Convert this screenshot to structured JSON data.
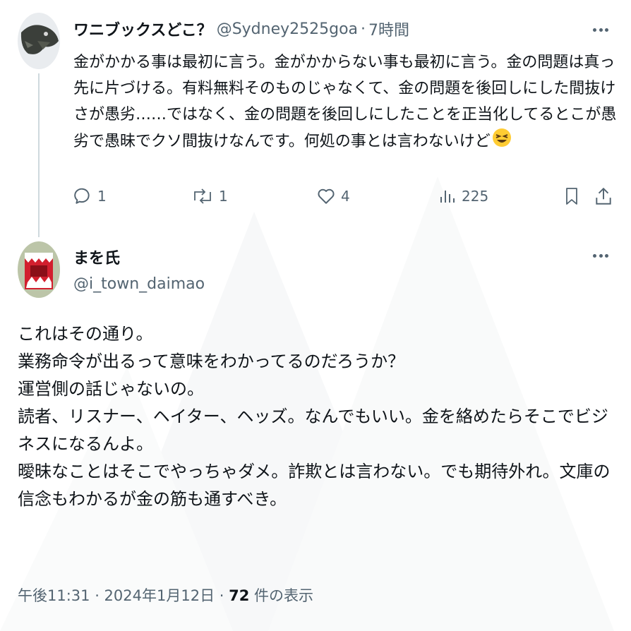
{
  "colors": {
    "text_primary": "#0f1419",
    "text_secondary": "#536471",
    "thread_line": "#cfd9de",
    "background": "#ffffff"
  },
  "tweet1": {
    "display_name": "ワニブックスどこ？",
    "handle": "@Sydney2525goa",
    "separator": "·",
    "time": "7時間",
    "text": "金がかかる事は最初に言う。金がかからない事も最初に言う。金の問題は真っ先に片づける。有料無料そのものじゃなくて、金の問題を後回しにした間抜けさが愚劣……ではなく、金の問題を後回しにしたことを正当化してるとこが愚劣で愚昧でクソ間抜けなんです。何処の事とは言わないけど",
    "emoji": "grinning-squinting-face",
    "avatar_icon": "lizard-avatar",
    "more_icon": "more-icon",
    "actions": {
      "reply_icon": "reply-icon",
      "reply_count": "1",
      "retweet_icon": "retweet-icon",
      "retweet_count": "1",
      "like_icon": "heart-icon",
      "like_count": "4",
      "views_icon": "views-icon",
      "views_count": "225",
      "bookmark_icon": "bookmark-icon",
      "share_icon": "share-icon"
    }
  },
  "tweet2": {
    "display_name": "まを氏",
    "handle": "@i_town_daimao",
    "avatar_icon": "red-monster-avatar",
    "more_icon": "more-icon",
    "text": "これはその通り。\n業務命令が出るって意味をわかってるのだろうか？\n運営側の話じゃないの。\n読者、リスナー、ヘイター、ヘッズ。なんでもいい。金を絡めたらそこでビジネスになるんよ。\n曖昧なことはそこでやっちゃダメ。詐欺とは言わない。でも期待外れ。文庫の信念もわかるが金の筋も通すべき。",
    "timestamp": "午後11:31 · 2024年1月12日 · ",
    "views_count": "72",
    "views_label": " 件の表示"
  }
}
